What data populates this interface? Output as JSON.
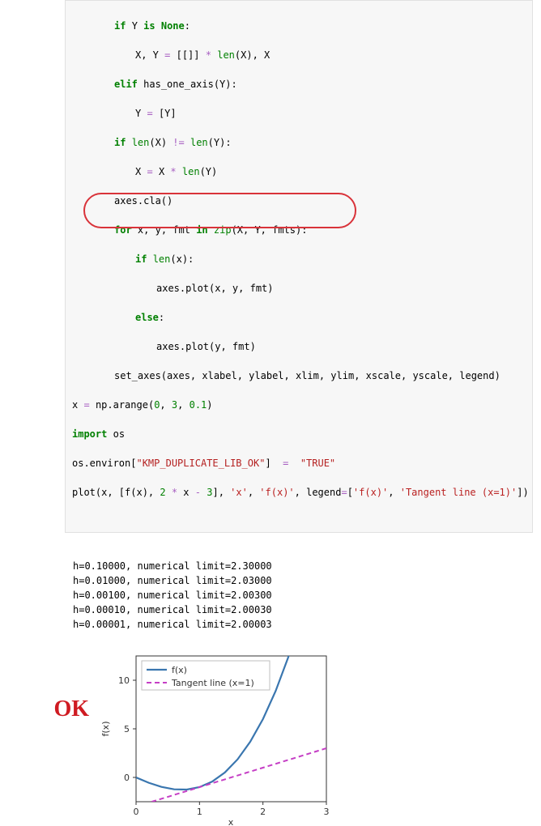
{
  "code": {
    "l0_if": "if",
    "l0_y": "Y",
    "l0_is": "is",
    "l0_none": "None",
    "l1_xy": "X, Y",
    "l1_eq": "=",
    "l1_val": "[[]]",
    "l1_star": "*",
    "l1_len": "len",
    "l1_tail": "(X), X",
    "l2_elif": "elif",
    "l2_call": "has_one_axis(Y):",
    "l3_y": "Y",
    "l3_eq": "=",
    "l3_val": "[Y]",
    "l4_if": "if",
    "l4_len": "len",
    "l4_a": "(X)",
    "l4_ne": "!=",
    "l4_len2": "len",
    "l4_b": "(Y):",
    "l5_x": "X",
    "l5_eq": "=",
    "l5_xx": "X",
    "l5_star": "*",
    "l5_len": "len",
    "l5_tail": "(Y)",
    "l6": "axes.cla()",
    "l7_for": "for",
    "l7_vars": "x, y, fmt",
    "l7_in": "in",
    "l7_zip": "zip",
    "l7_tail": "(X, Y, fmts):",
    "l8_if": "if",
    "l8_len": "len",
    "l8_tail": "(x):",
    "l9": "axes.plot(x, y, fmt)",
    "l10_else": "else",
    "l10_colon": ":",
    "l11": "axes.plot(y, fmt)",
    "l12": "set_axes(axes, xlabel, ylabel, xlim, ylim, xscale, yscale, legend)",
    "l13_x": "x",
    "l13_eq": "=",
    "l13_call": "np.arange(",
    "l13_a": "0",
    "l13_c1": ",",
    "l13_b": "3",
    "l13_c2": ",",
    "l13_c": "0.1",
    "l13_close": ")",
    "l14_import": "import",
    "l14_os": "os",
    "l15_env": "os.environ[",
    "l15_key": "\"KMP_DUPLICATE_LIB_OK\"",
    "l15_mid": "]  ",
    "l15_eq": "=",
    "l15_val": "\"TRUE\"",
    "l16_a": "plot(x, [f(x), ",
    "l16_b": "2",
    "l16_star": "*",
    "l16_c": " x ",
    "l16_minus": "-",
    "l16_d": "3",
    "l16_e": "], ",
    "l16_s1": "'x'",
    "l16_f": ", ",
    "l16_s2": "'f(x)'",
    "l16_g": ", legend",
    "l16_eq": "=",
    "l16_h": "[",
    "l16_s3": "'f(x)'",
    "l16_i": ", ",
    "l16_s4": "'Tangent line (x=1)'",
    "l16_j": "])"
  },
  "output": {
    "line0": "h=0.10000, numerical limit=2.30000",
    "line1": "h=0.01000, numerical limit=2.03000",
    "line2": "h=0.00100, numerical limit=2.00300",
    "line3": "h=0.00010, numerical limit=2.00030",
    "line4": "h=0.00001, numerical limit=2.00003"
  },
  "annotation": {
    "ok": "OK"
  },
  "chart_data": {
    "type": "line",
    "xlabel": "x",
    "ylabel": "f(x)",
    "xlim": [
      0,
      3
    ],
    "ylim": [
      -2.5,
      12.5
    ],
    "xticks": [
      0,
      1,
      2,
      3
    ],
    "yticks": [
      0,
      5,
      10
    ],
    "legend_position": "upper-left",
    "series": [
      {
        "name": "f(x)",
        "style": "solid",
        "color": "#3a76af",
        "x": [
          0.0,
          0.2,
          0.4,
          0.6,
          0.8,
          1.0,
          1.2,
          1.4,
          1.6,
          1.8,
          2.0,
          2.2,
          2.4,
          2.6,
          2.8
        ],
        "values": [
          0.0,
          -0.552,
          -0.976,
          -1.224,
          -1.248,
          -1.0,
          -0.432,
          0.504,
          1.856,
          3.672,
          6.0,
          8.888,
          12.384,
          16.536,
          21.392
        ]
      },
      {
        "name": "Tangent line (x=1)",
        "style": "dashed",
        "color": "#c53ec5",
        "x": [
          0.0,
          3.0
        ],
        "values": [
          -3.0,
          3.0
        ]
      }
    ]
  }
}
